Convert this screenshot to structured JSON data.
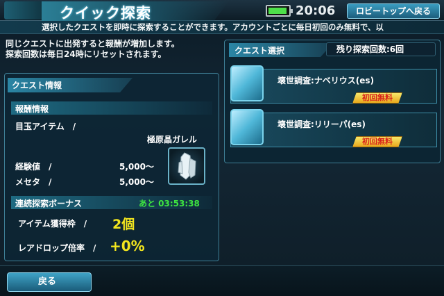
{
  "header": {
    "title": "クイック探索",
    "clock": "20:06",
    "lobby_button": "ロビートップへ戻る",
    "battery_level": 0.8
  },
  "description": "選択したクエストを即時に探索することができます。アカウントごとに毎日初回のみ無料で、以",
  "notice": {
    "line1": "同じクエストに出発すると報酬が増加します。",
    "line2": "探索回数は毎日24時にリセットされます。"
  },
  "quest_info": {
    "header": "クエスト情報",
    "reward_header": "報酬情報",
    "featured_item_label": "目玉アイテム　/",
    "item_name": "極原晶ガレル",
    "item_icon": "crystal-icon",
    "exp_label": "経験値　/",
    "exp_value": "5,000〜",
    "meseta_label": "メセタ　/",
    "meseta_value": "5,000〜",
    "bonus_header": "連続探索ボーナス",
    "remaining_time": "あと 03:53:38",
    "drop_slots_label": "アイテム獲得枠　/",
    "drop_slots_value": "2個",
    "rare_drop_label": "レアドロップ倍率　/",
    "rare_drop_value": "+0%"
  },
  "quest_select": {
    "header": "クエスト選択",
    "searches_left": "残り探索回数:6回",
    "quests": [
      {
        "name": "壊世調査:ナベリウス(es)",
        "badge": "初回無料"
      },
      {
        "name": "壊世調査:リリーパ(es)",
        "badge": "初回無料"
      }
    ]
  },
  "footer": {
    "back_button": "戻る"
  },
  "colors": {
    "accent": "#2b86a5",
    "timer_green": "#3ee640",
    "value_yellow": "#f2e51e",
    "badge_red": "#d8221a"
  }
}
